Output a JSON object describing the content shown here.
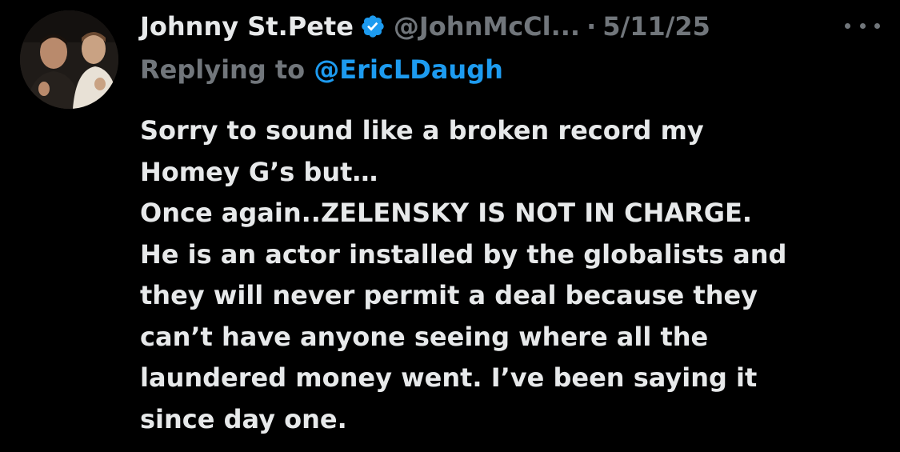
{
  "tweet": {
    "author": {
      "display_name": "Johnny St.Pete",
      "handle": "@JohnMcCl...",
      "verified": true,
      "avatar_icon": "profile-photo"
    },
    "separator": "·",
    "date": "5/11/25",
    "more_icon": "ellipsis-icon",
    "reply": {
      "prefix": "Replying to",
      "handle": "@EricLDaugh"
    },
    "body_lines": [
      "Sorry to sound like a broken record my",
      "Homey G’s but…",
      "Once again..ZELENSKY IS NOT IN CHARGE.",
      "He is an actor installed by the globalists and",
      "they will never permit a deal because they",
      "can’t have anyone seeing where all the",
      "laundered money went. I’ve been saying it",
      "since day one."
    ]
  },
  "colors": {
    "background": "#000000",
    "primary_text": "#e7e9ea",
    "secondary_text": "#71767b",
    "link": "#1d9bf0",
    "verified_badge": "#1d9bf0"
  }
}
